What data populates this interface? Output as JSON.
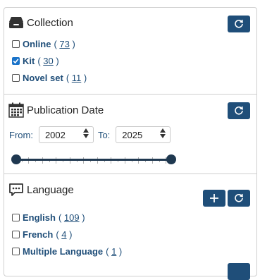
{
  "collection": {
    "title": "Collection",
    "items": [
      {
        "label": "Online",
        "count": "73",
        "checked": false
      },
      {
        "label": "Kit",
        "count": "30",
        "checked": true
      },
      {
        "label": "Novel set",
        "count": "11",
        "checked": false
      }
    ]
  },
  "publication_date": {
    "title": "Publication Date",
    "from_label": "From:",
    "from_value": "2002",
    "to_label": "To:",
    "to_value": "2025"
  },
  "language": {
    "title": "Language",
    "items": [
      {
        "label": "English",
        "count": "109",
        "checked": false
      },
      {
        "label": "French",
        "count": "4",
        "checked": false
      },
      {
        "label": "Multiple Language",
        "count": "1",
        "checked": false
      }
    ]
  },
  "colors": {
    "button_bg": "#1f4e79",
    "link_text": "#1f4e79",
    "checkbox_checked": "#1a73c9"
  },
  "icons": {
    "collection": "archive-box-icon",
    "publication_date": "calendar-icon",
    "language": "speech-bubble-icon",
    "reset": "refresh-icon",
    "add": "plus-icon"
  }
}
